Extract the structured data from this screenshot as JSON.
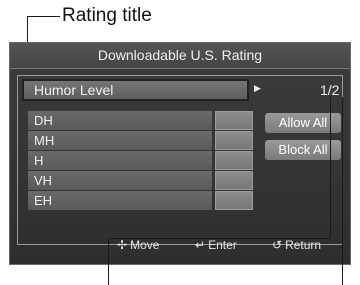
{
  "annotation": {
    "label": "Rating title"
  },
  "window": {
    "title": "Downloadable U.S. Rating"
  },
  "rating": {
    "title": "Humor Level",
    "page": "1/2"
  },
  "levels": [
    "DH",
    "MH",
    "H",
    "VH",
    "EH"
  ],
  "actions": {
    "allow_all": "Allow All",
    "block_all": "Block All"
  },
  "footer": {
    "move": "Move",
    "enter": "Enter",
    "return": "Return"
  },
  "icons": {
    "arrow": "triangle-right-icon",
    "move": "four-way-arrow-icon",
    "enter": "enter-icon",
    "return": "return-icon"
  }
}
